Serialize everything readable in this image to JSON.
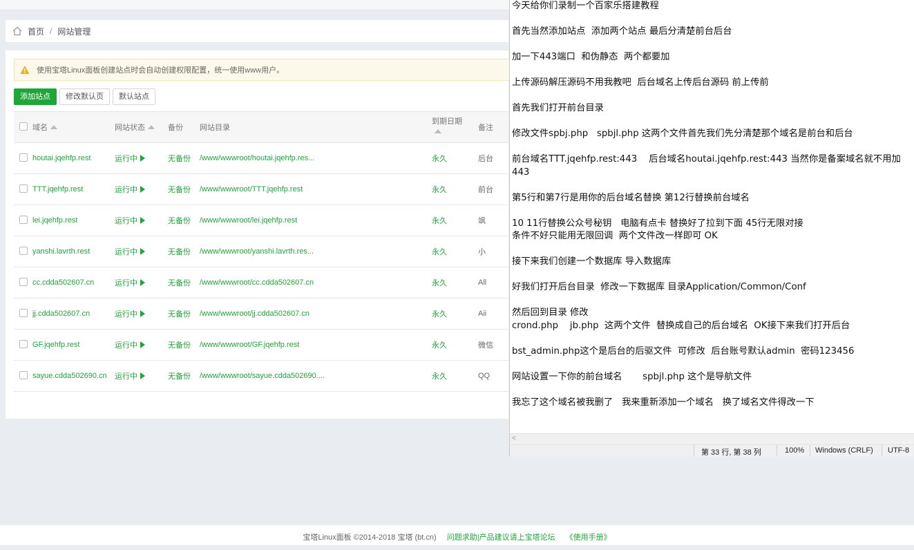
{
  "breadcrumb": {
    "home": "首页",
    "separator": "/",
    "current": "网站管理"
  },
  "notice": "使用宝塔Linux面板创建站点时会自动创建权限配置，统一使用www用户。",
  "buttons": {
    "add_site": "添加站点",
    "edit_default_page": "修改默认页",
    "default_site": "默认站点"
  },
  "table": {
    "headers": {
      "domain": "域名",
      "status": "网站状态",
      "backup": "备份",
      "root": "网站目录",
      "expire": "到期日期",
      "note": "备注"
    },
    "rows": [
      {
        "domain": "houtai.jqehfp.rest",
        "status": "运行中",
        "backup": "无备份",
        "root": "/www/wwwroot/houtai.jqehfp.res...",
        "expire": "永久",
        "note": "后台"
      },
      {
        "domain": "TTT.jqehfp.rest",
        "status": "运行中",
        "backup": "无备份",
        "root": "/www/wwwroot/TTT.jqehfp.rest",
        "expire": "永久",
        "note": "前台"
      },
      {
        "domain": "lei.jqehfp.rest",
        "status": "运行中",
        "backup": "无备份",
        "root": "/www/wwwroot/lei.jqehfp.rest",
        "expire": "永久",
        "note": "飒"
      },
      {
        "domain": "yanshi.lavrth.rest",
        "status": "运行中",
        "backup": "无备份",
        "root": "/www/wwwroot/yanshi.lavrth.res...",
        "expire": "永久",
        "note": "小"
      },
      {
        "domain": "cc.cdda502607.cn",
        "status": "运行中",
        "backup": "无备份",
        "root": "/www/wwwroot/cc.cdda502607.cn",
        "expire": "永久",
        "note": "All"
      },
      {
        "domain": "jj.cdda502607.cn",
        "status": "运行中",
        "backup": "无备份",
        "root": "/www/wwwroot/jj.cdda502607.cn",
        "expire": "永久",
        "note": "Aii"
      },
      {
        "domain": "GF.jqehfp.rest",
        "status": "运行中",
        "backup": "无备份",
        "root": "/www/wwwroot/GF.jqehfp.rest",
        "expire": "永久",
        "note": "微信"
      },
      {
        "domain": "sayue.cdda502690.cn",
        "status": "运行中",
        "backup": "无备份",
        "root": "/www/wwwroot/sayue.cdda502690....",
        "expire": "永久",
        "note": "QQ"
      }
    ]
  },
  "footer": {
    "copyright": "宝塔Linux面板 ©2014-2018 宝塔 (bt.cn)",
    "forum_link": "问题求助|产品建议请上宝塔论坛",
    "manual_link": "《使用手册》"
  },
  "notepad": {
    "lines": [
      "今天给你们录制一个百家乐搭建教程",
      "",
      "首先当然添加站点  添加两个站点 最后分清楚前台后台",
      "",
      "加一下443端口  和伪静态  两个都要加",
      "",
      "上传源码解压源码不用我教吧  后台域名上传后台源码 前上传前",
      "",
      "首先我们打开前台目录",
      "",
      "修改文件spbj.php   spbjl.php 这两个文件首先我们先分清楚那个域名是前台和后台",
      "",
      "前台域名TTT.jqehfp.rest:443    后台域名houtai.jqehfp.rest:443 当然你是备案域名就不用加443",
      "",
      "第5行和第7行是用你的后台域名替换 第12行替换前台域名",
      "",
      "10 11行替换公众号秘钥   电脑有点卡 替换好了拉到下面 45行无限对接",
      "条件不好只能用无限回调  两个文件改一样即可 OK",
      "",
      "接下来我们创建一个数据库 导入数据库",
      "",
      "好我们打开后台目录  修改一下数据库 目录Application/Common/Conf",
      "",
      "然后回到目录 修改",
      "crond.php    jb.php  这两个文件  替换成自己的后台域名  OK接下来我们打开后台",
      "",
      "bst_admin.php这个是后台的后驱文件  可修改  后台账号默认admin  密码123456",
      "",
      "网站设置一下你的前台域名       spbjl.php 这个是导航文件",
      "",
      "我忘了这个域名被我删了   我来重新添加一个域名   换了域名文件得改一下"
    ],
    "status": {
      "position": "第 33 行, 第 38 列",
      "zoom": "100%",
      "line_ending": "Windows (CRLF)",
      "encoding": "UTF-8"
    }
  }
}
